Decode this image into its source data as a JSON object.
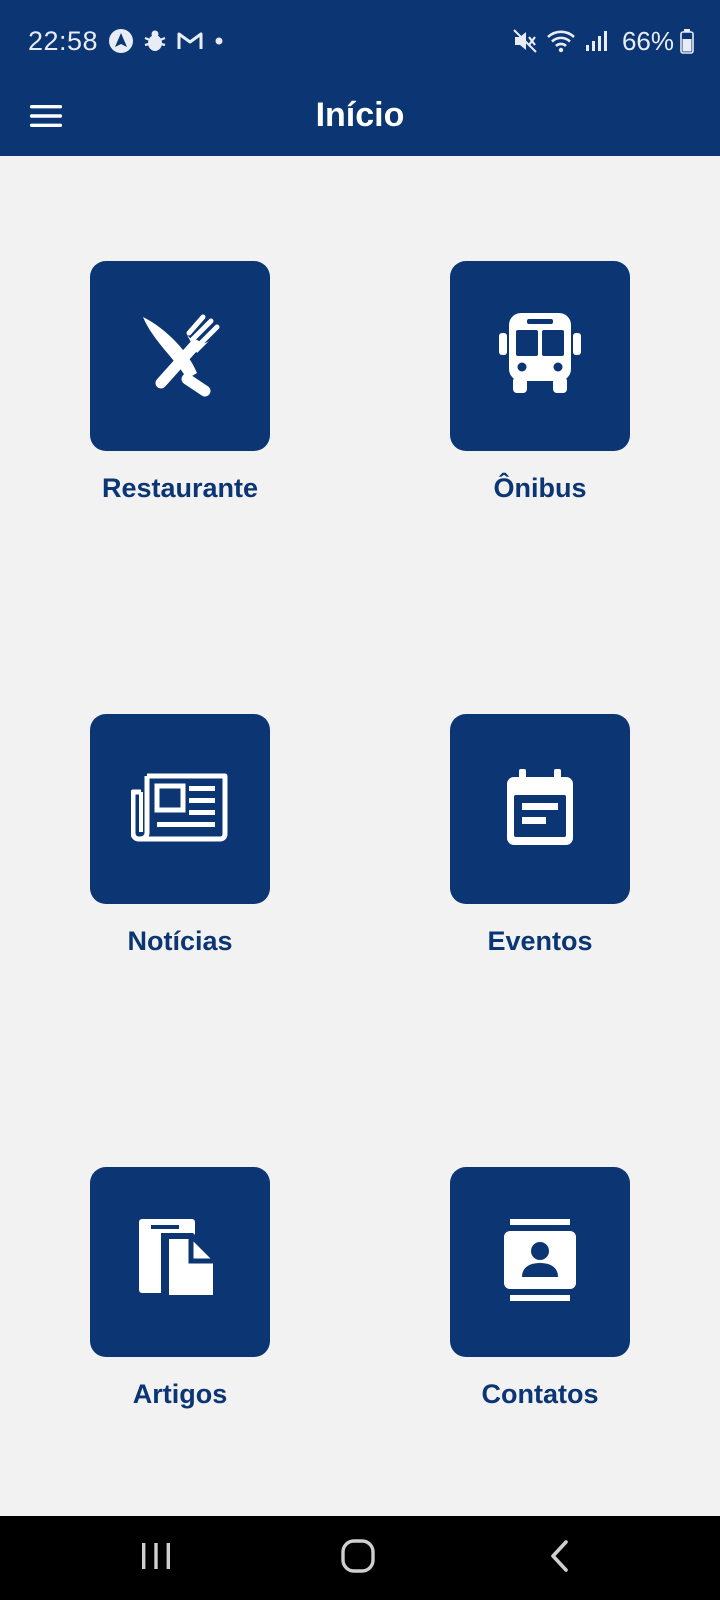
{
  "status_bar": {
    "time": "22:58",
    "battery": "66%",
    "left_icons": [
      "location-arrow-icon",
      "bug-icon",
      "gmail-icon",
      "dot-icon"
    ],
    "right_icons": [
      "mute-icon",
      "wifi-icon",
      "signal-icon",
      "battery-icon"
    ]
  },
  "app_bar": {
    "title": "Início",
    "menu_icon": "hamburger-menu-icon"
  },
  "tiles": [
    {
      "label": "Restaurante",
      "icon": "utensils-icon"
    },
    {
      "label": "Ônibus",
      "icon": "bus-icon"
    },
    {
      "label": "Notícias",
      "icon": "newspaper-icon"
    },
    {
      "label": "Eventos",
      "icon": "calendar-icon"
    },
    {
      "label": "Artigos",
      "icon": "documents-icon"
    },
    {
      "label": "Contatos",
      "icon": "contacts-icon"
    }
  ],
  "nav_bar": {
    "recents_icon": "recents-icon",
    "home_icon": "home-icon",
    "back_icon": "back-icon"
  },
  "colors": {
    "primary": "#0b3573",
    "background": "#f2f2f2",
    "nav_background": "#000000"
  }
}
